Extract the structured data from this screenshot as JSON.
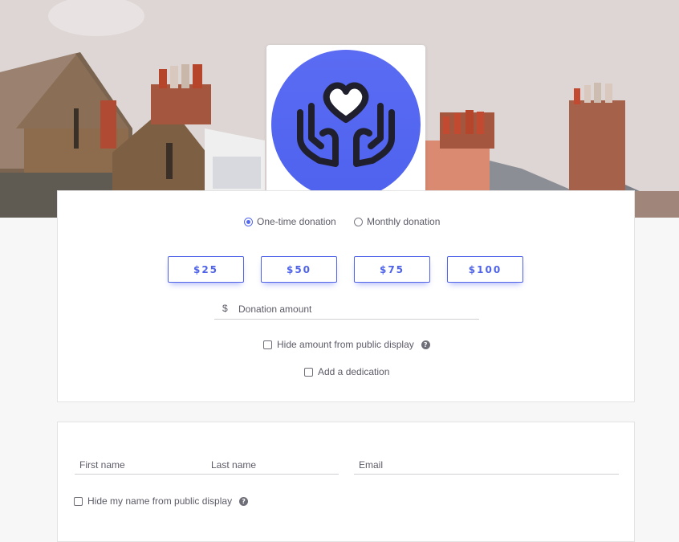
{
  "hero": {
    "image": "rooftops-chimneys-photo"
  },
  "logo": {
    "icon": "hands-heart-icon",
    "bg_color": "#5469f0",
    "fg_color": "#1f1f2e"
  },
  "frequency": {
    "one_time_label": "One-time donation",
    "monthly_label": "Monthly donation",
    "selected": "one_time"
  },
  "amounts": [
    "$25",
    "$50",
    "$75",
    "$100"
  ],
  "amount_input": {
    "currency": "$",
    "placeholder": "Donation amount",
    "value": ""
  },
  "options": {
    "hide_amount_label": "Hide amount from public display",
    "dedication_label": "Add a dedication"
  },
  "donor": {
    "first_name_placeholder": "First name",
    "last_name_placeholder": "Last name",
    "email_placeholder": "Email",
    "hide_name_label": "Hide my name from public display"
  },
  "colors": {
    "accent": "#5469f0",
    "text": "#5c5c68",
    "card_border": "#e3e3e3"
  }
}
